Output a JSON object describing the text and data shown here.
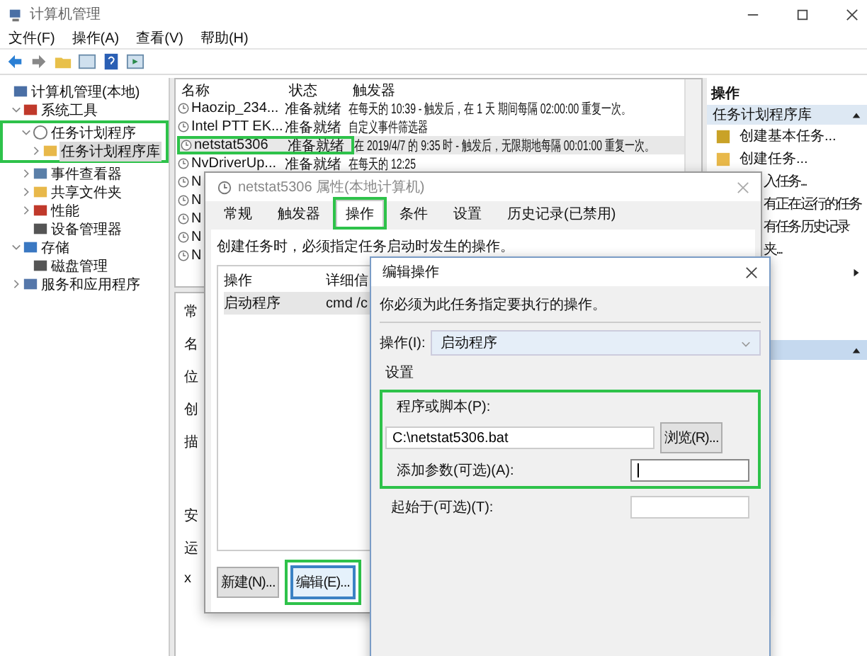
{
  "window": {
    "title": "计算机管理"
  },
  "menu": [
    "文件(F)",
    "操作(A)",
    "查看(V)",
    "帮助(H)"
  ],
  "tree": [
    {
      "label": "计算机管理(本地)",
      "kind": "computer",
      "selected": false,
      "children": [
        {
          "label": "系统工具",
          "kind": "tools",
          "expanded": true,
          "selected": false,
          "children": [
            {
              "label": "任务计划程序",
              "kind": "clock",
              "expanded": true,
              "selected": false,
              "highlighted": true,
              "children": [
                {
                  "label": "任务计划程序库",
                  "kind": "folder",
                  "expanded": false,
                  "selected": true
                }
              ]
            },
            {
              "label": "事件查看器",
              "kind": "viewer",
              "expanded": false,
              "selected": false
            },
            {
              "label": "共享文件夹",
              "kind": "folder",
              "expanded": false,
              "selected": false
            },
            {
              "label": "性能",
              "kind": "perf",
              "expanded": false,
              "selected": false
            },
            {
              "label": "设备管理器",
              "kind": "device",
              "selected": false
            }
          ]
        },
        {
          "label": "存储",
          "kind": "storage",
          "expanded": true,
          "selected": false,
          "children": [
            {
              "label": "磁盘管理",
              "kind": "disk",
              "selected": false
            }
          ]
        },
        {
          "label": "服务和应用程序",
          "kind": "services",
          "expanded": false,
          "selected": false
        }
      ]
    }
  ],
  "tasks": {
    "columns": [
      "名称",
      "状态",
      "触发器"
    ],
    "rows": [
      {
        "name": "Haozip_234...",
        "status": "准备就绪",
        "trigger": "在每天的 10:39 - 触发后，在 1 天 期间每隔 02:00:00 重复一次。",
        "selected": false,
        "highlighted": false
      },
      {
        "name": "Intel PTT EK...",
        "status": "准备就绪",
        "trigger": "自定义事件筛选器",
        "selected": false,
        "highlighted": false
      },
      {
        "name": "netstat5306",
        "status": "准备就绪",
        "trigger": "在 2019/4/7 的 9:35 时 - 触发后，无限期地每隔 00:01:00 重复一次。",
        "selected": true,
        "highlighted": true
      },
      {
        "name": "NvDriverUp...",
        "status": "准备就绪",
        "trigger": "在每天的 12:25",
        "selected": false,
        "highlighted": false
      },
      {
        "name": "N",
        "selected": false,
        "highlighted": false
      },
      {
        "name": "N",
        "selected": false,
        "highlighted": false
      },
      {
        "name": "N",
        "selected": false,
        "highlighted": false
      },
      {
        "name": "N",
        "selected": false,
        "highlighted": false
      },
      {
        "name": "N",
        "selected": false,
        "highlighted": false
      }
    ]
  },
  "lower_pane": {
    "tab": "常",
    "fields": [
      "名",
      "位",
      "创",
      "描"
    ],
    "fields_bottom": [
      "安",
      "运",
      "x"
    ]
  },
  "actions": {
    "title": "操作",
    "sections": [
      {
        "title": "任务计划程序库",
        "selected": false,
        "items": [
          {
            "kind": "task",
            "label": "创建基本任务..."
          },
          {
            "kind": "new",
            "label": "创建任务..."
          },
          {
            "kind": "partial",
            "label": "入任务..."
          },
          {
            "kind": "partial",
            "label": "有正在运行的任务"
          },
          {
            "kind": "partial",
            "label": "有任务历史记录"
          },
          {
            "kind": "partial",
            "label": "夹..."
          },
          {
            "kind": "submenu"
          }
        ]
      },
      {
        "selected": true
      }
    ]
  },
  "properties": {
    "title": "netstat5306 属性(本地计算机)",
    "tabs": [
      {
        "label": "常规",
        "selected": false,
        "highlighted": false
      },
      {
        "label": "触发器",
        "selected": false,
        "highlighted": false
      },
      {
        "label": "操作",
        "selected": true,
        "highlighted": true
      },
      {
        "label": "条件",
        "selected": false,
        "highlighted": false
      },
      {
        "label": "设置",
        "selected": false,
        "highlighted": false
      },
      {
        "label": "历史记录(已禁用)",
        "selected": false,
        "highlighted": false
      }
    ],
    "hint": "创建任务时，必须指定任务启动时发生的操作。",
    "columns": [
      "操作",
      "详细信"
    ],
    "rows": [
      {
        "action": "启动程序",
        "details": "cmd /c",
        "selected": true
      }
    ],
    "buttons": [
      {
        "label": "新建(N)...",
        "focused": false,
        "highlighted": false
      },
      {
        "label": "编辑(E)...",
        "focused": true,
        "highlighted": true
      }
    ]
  },
  "edit_dialog": {
    "title": "编辑操作",
    "hint": "你必须为此任务指定要执行的操作。",
    "action_label": "操作(I):",
    "action_value": "启动程序",
    "settings_label": "设置",
    "program_highlighted": true,
    "program_label": "程序或脚本(P):",
    "program_value": "C:\\netstat5306.bat",
    "browse": "浏览(R)...",
    "args_label": "添加参数(可选)(A):",
    "args_focused": true,
    "start_label": "起始于(可选)(T):"
  }
}
